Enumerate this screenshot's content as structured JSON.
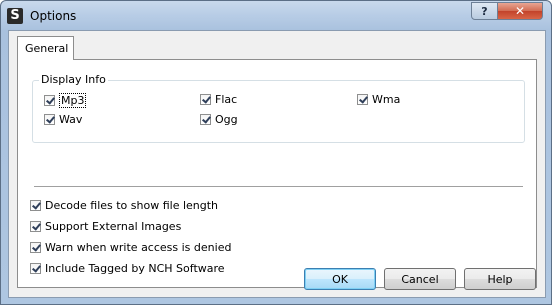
{
  "window": {
    "title": "Options",
    "help_glyph": "?",
    "close_glyph": "✕",
    "app_icon_letter": "S"
  },
  "tabs": [
    {
      "label": "General",
      "selected": true
    }
  ],
  "display_info": {
    "legend": "Display Info",
    "items": [
      {
        "label": "Mp3",
        "checked": true
      },
      {
        "label": "Flac",
        "checked": true
      },
      {
        "label": "Wma",
        "checked": true
      },
      {
        "label": "Wav",
        "checked": true
      },
      {
        "label": "Ogg",
        "checked": true
      }
    ]
  },
  "options": [
    {
      "label": "Decode files to show file length",
      "checked": true
    },
    {
      "label": "Support External Images",
      "checked": true
    },
    {
      "label": "Warn when write access is denied",
      "checked": true
    },
    {
      "label": "Include Tagged by NCH Software",
      "checked": true
    }
  ],
  "buttons": {
    "ok": "OK",
    "cancel": "Cancel",
    "help": "Help"
  }
}
